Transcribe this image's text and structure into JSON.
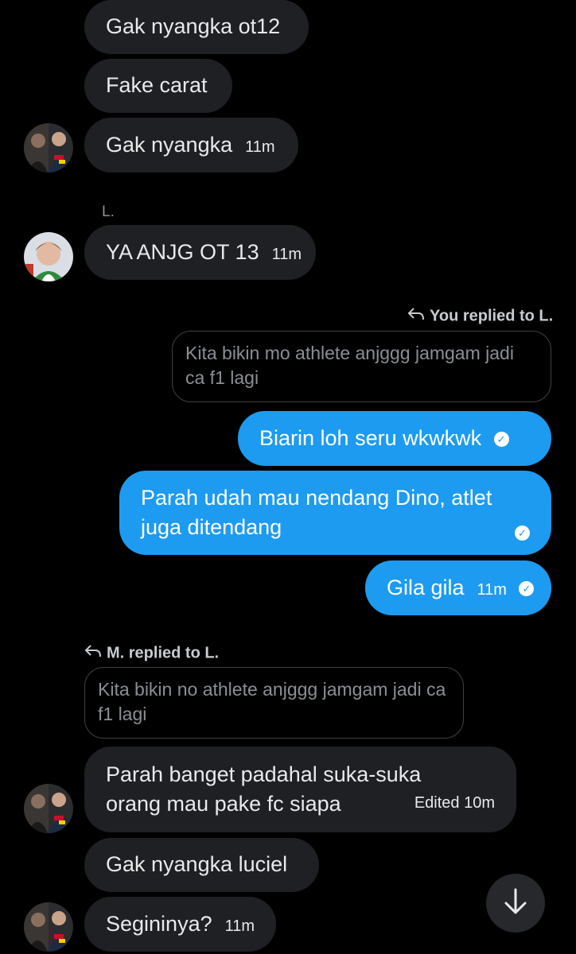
{
  "messages_top": [
    {
      "text": "Gak nyangka ot12"
    },
    {
      "text": "Fake carat"
    },
    {
      "text": "Gak nyangka",
      "time": "11m"
    }
  ],
  "sender_l": {
    "name": "L.",
    "message": "YA ANJG OT 13",
    "time": "11m"
  },
  "my_reply": {
    "label": "You replied to L.",
    "quote": "Kita bikin mo athlete anjggg jamgam jadi ca f1 lagi",
    "messages": [
      {
        "text": "Biarin loh seru wkwkwk"
      },
      {
        "text": "Parah udah mau nendang Dino, atlet juga ditendang"
      },
      {
        "text": "Gila gila",
        "time": "11m"
      }
    ]
  },
  "m_reply": {
    "label": "M. replied to L.",
    "quote": "Kita bikin no athlete anjggg jamgam jadi ca f1 lagi",
    "message": "Parah banget padahal suka-suka orang mau pake fc siapa",
    "edited": "Edited 10m"
  },
  "messages_bottom": [
    {
      "text": "Gak nyangka luciel"
    },
    {
      "text": "Segininya?",
      "time": "11m"
    }
  ],
  "icons": {
    "reply": "reply-arrow-icon",
    "check": "sent-check-icon",
    "scroll": "arrow-down-icon"
  },
  "colors": {
    "background": "#000000",
    "incoming": "#1f2024",
    "outgoing": "#1d9bf0"
  }
}
